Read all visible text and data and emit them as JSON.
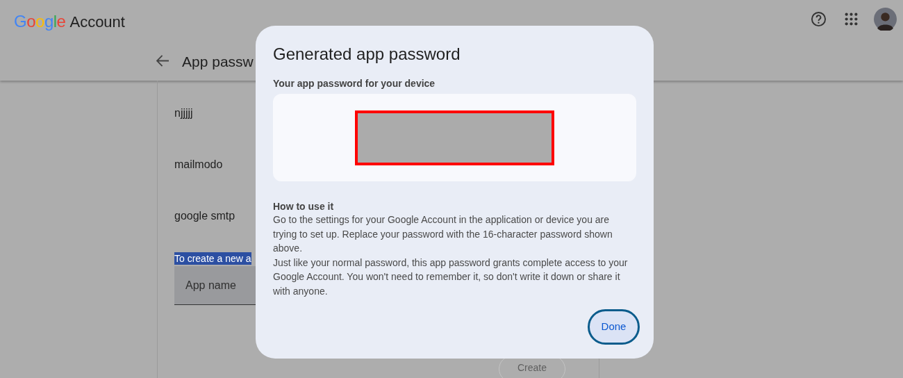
{
  "header": {
    "logo_word": "Google",
    "product": "Account"
  },
  "page": {
    "title": "App passw",
    "passwords": [
      "njjjjj",
      "mailmodo",
      "google smtp"
    ],
    "selected_text": {
      "text": "To create a new a",
      "highlighted": true
    },
    "app_name": {
      "placeholder": "App name"
    },
    "create_button": "Create"
  },
  "dialog": {
    "title": "Generated app password",
    "subtitle": "Your app password for your device",
    "howto_title": "How to use it",
    "howto_paragraphs": [
      "Go to the settings for your Google Account in the application or device you are trying to set up. Replace your password with the 16-character password shown above.",
      "Just like your normal password, this app password grants complete access to your Google Account. You won't need to remember it, so don't write it down or share it with anyone."
    ],
    "done_button": "Done"
  }
}
